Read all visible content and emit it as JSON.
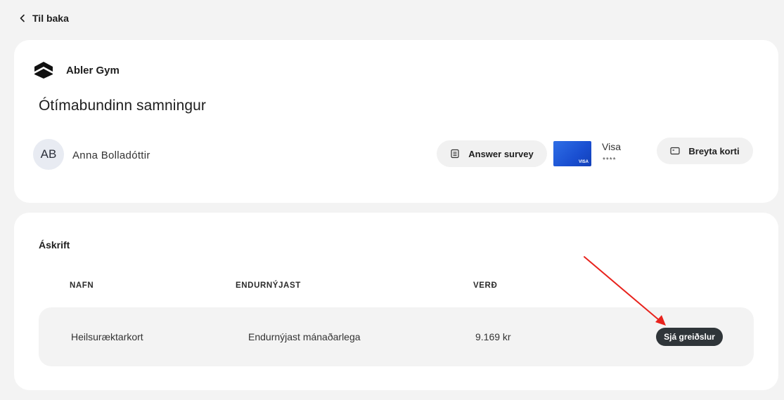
{
  "nav": {
    "back_label": "Til baka"
  },
  "gym": {
    "name": "Abler Gym"
  },
  "contract": {
    "title": "Ótímabundinn samningur"
  },
  "member": {
    "initials": "AB",
    "name": "Anna Bolladóttir"
  },
  "actions": {
    "survey_label": "Answer survey",
    "change_card_label": "Breyta korti"
  },
  "payment_card": {
    "brand": "Visa",
    "masked_number": "****",
    "card_logo_text": "VISA"
  },
  "subscription": {
    "section_title": "Áskrift",
    "columns": {
      "name": "NAFN",
      "renews": "ENDURNÝJAST",
      "price": "VERÐ"
    },
    "rows": [
      {
        "name": "Heilsuræktarkort",
        "renews": "Endurnýjast mánaðarlega",
        "price": "9.169 kr",
        "action_label": "Sjá greiðslur"
      }
    ]
  },
  "colors": {
    "annotation_arrow": "#e8221c",
    "pay_button": "#2f3539",
    "page_bg": "#f3f3f3"
  }
}
